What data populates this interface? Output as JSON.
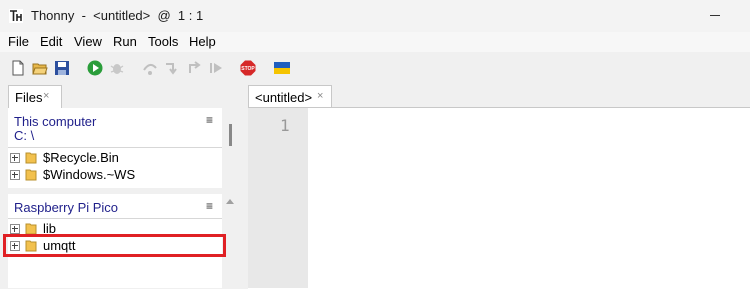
{
  "window": {
    "title": "Thonny  -  <untitled>  @  1 : 1"
  },
  "menu": [
    "File",
    "Edit",
    "View",
    "Run",
    "Tools",
    "Help"
  ],
  "toolbar": {
    "icons": [
      "new-file-icon",
      "open-file-icon",
      "save-icon",
      "run-icon",
      "debug-icon",
      "step-over-icon",
      "step-into-icon",
      "step-out-icon",
      "resume-icon",
      "stop-icon",
      "ukraine-flag-icon"
    ],
    "colors": {
      "run": "#2a9d3a",
      "stop": "#d62828",
      "flag_blue": "#1f5fbf",
      "flag_yellow": "#f5c400"
    }
  },
  "files_pane": {
    "tab_label": "Files",
    "tab_close": "×",
    "this_computer": {
      "header": "This computer",
      "path": "C: \\",
      "menu_icon": "≡",
      "items": [
        "$Recycle.Bin",
        "$Windows.~WS"
      ]
    },
    "pico": {
      "header": "Raspberry Pi Pico",
      "menu_icon": "≡",
      "items": [
        "lib",
        "umqtt"
      ]
    }
  },
  "editor": {
    "tab_label": "<untitled>",
    "tab_close": "×",
    "line_numbers": [
      "1"
    ]
  },
  "highlight_color": "#e02024"
}
